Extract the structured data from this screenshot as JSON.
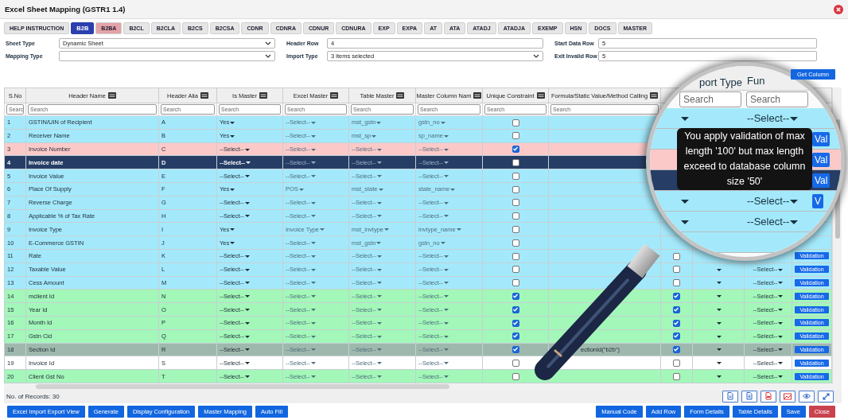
{
  "window": {
    "title": "Excel Sheet Mapping (GSTR1 1.4)"
  },
  "tabs": [
    {
      "label": "HELP INSTRUCTION",
      "selected": false,
      "color": "#e6e6e6"
    },
    {
      "label": "B2B",
      "selected": true
    },
    {
      "label": "B2BA",
      "selected": false,
      "color": "#e4a3a8"
    },
    {
      "label": "B2CL",
      "selected": false,
      "color": "#e6e6e6"
    },
    {
      "label": "B2CLA",
      "selected": false,
      "color": "#e6e6e6"
    },
    {
      "label": "B2CS",
      "selected": false,
      "color": "#e6e6e6"
    },
    {
      "label": "B2CSA",
      "selected": false,
      "color": "#e6e6e6"
    },
    {
      "label": "CDNR",
      "selected": false,
      "color": "#e6e6e6"
    },
    {
      "label": "CDNRA",
      "selected": false,
      "color": "#e6e6e6"
    },
    {
      "label": "CDNUR",
      "selected": false,
      "color": "#e6e6e6"
    },
    {
      "label": "CDNURA",
      "selected": false,
      "color": "#e6e6e6"
    },
    {
      "label": "EXP",
      "selected": false,
      "color": "#e6e6e6"
    },
    {
      "label": "EXPA",
      "selected": false,
      "color": "#e6e6e6"
    },
    {
      "label": "AT",
      "selected": false,
      "color": "#e6e6e6"
    },
    {
      "label": "ATA",
      "selected": false,
      "color": "#e6e6e6"
    },
    {
      "label": "ATADJ",
      "selected": false,
      "color": "#e6e6e6"
    },
    {
      "label": "ATADJA",
      "selected": false,
      "color": "#e6e6e6"
    },
    {
      "label": "EXEMP",
      "selected": false,
      "color": "#e6e6e6"
    },
    {
      "label": "HSN",
      "selected": false,
      "color": "#e6e6e6"
    },
    {
      "label": "DOCS",
      "selected": false,
      "color": "#e6e6e6"
    },
    {
      "label": "MASTER",
      "selected": false,
      "color": "#e6e6e6"
    }
  ],
  "form": {
    "fields": [
      {
        "label": "Sheet Type",
        "kind": "select",
        "value": "Dynamic Sheet"
      },
      {
        "label": "Header Row",
        "kind": "input",
        "value": "4"
      },
      {
        "label": "Start Data Row",
        "kind": "input",
        "value": "5"
      },
      {
        "label": "Mapping Type",
        "kind": "select"
      },
      {
        "label": "Import Type",
        "kind": "select",
        "value": "3 items selected"
      },
      {
        "label": "Exit Invalid Row",
        "kind": "input",
        "value": "5"
      }
    ]
  },
  "get_column_button": "Get Column",
  "table": {
    "columns": [
      {
        "label": "S.No",
        "search_placeholder": "Searc",
        "menu": false
      },
      {
        "label": "Header Name",
        "search_placeholder": "Search",
        "menu": true
      },
      {
        "label": "Header Alia",
        "search_placeholder": "Search",
        "menu": true
      },
      {
        "label": "Is Master",
        "search_placeholder": "Search",
        "menu": true
      },
      {
        "label": "Excel Master",
        "search_placeholder": "Search",
        "menu": true
      },
      {
        "label": "Table Master",
        "search_placeholder": "Search",
        "menu": true
      },
      {
        "label": "Master Column Nam",
        "search_placeholder": "Search",
        "menu": true
      },
      {
        "label": "Unique Constraint",
        "search_placeholder": "Search",
        "menu": true
      },
      {
        "label": "Formula/Static Value/Method Calling",
        "search_placeholder": "Search",
        "menu": true
      }
    ],
    "rows": [
      {
        "sno": "1",
        "header_name": "GSTIN/UIN of Recipient",
        "alias": "A",
        "is_master": "Yes",
        "excel_master": "--Select--",
        "table_master": "mst_gstn",
        "master_column": "gstn_no",
        "unique": false,
        "selected": false,
        "color": "#a4e9fb"
      },
      {
        "sno": "2",
        "header_name": "Receiver Name",
        "alias": "B",
        "is_master": "Yes",
        "excel_master": "--Select--",
        "table_master": "mst_sp",
        "master_column": "sp_name",
        "unique": false,
        "selected": false,
        "color": "#a4e9fb"
      },
      {
        "sno": "3",
        "header_name": "Invoice Number",
        "alias": "C",
        "is_master": "--Select--",
        "excel_master": "--Select--",
        "table_master": "--Select--",
        "master_column": "--Select--",
        "unique": true,
        "selected": false,
        "color": "#fcc9c9"
      },
      {
        "sno": "4",
        "header_name": "Invoice date",
        "alias": "D",
        "is_master": "--Select--",
        "excel_master": "--Select--",
        "table_master": "--Select--",
        "master_column": "--Select--",
        "unique": false,
        "selected": true
      },
      {
        "sno": "5",
        "header_name": "Invoice Value",
        "alias": "E",
        "is_master": "--Select--",
        "excel_master": "--Select--",
        "table_master": "--Select--",
        "master_column": "--Select--",
        "unique": false,
        "selected": false,
        "color": "#a4e9fb"
      },
      {
        "sno": "6",
        "header_name": "Place Of Supply",
        "alias": "F",
        "is_master": "Yes",
        "excel_master": "POS",
        "table_master": "mst_state",
        "master_column": "state_name",
        "unique": false,
        "selected": false,
        "color": "#a4e9fb"
      },
      {
        "sno": "7",
        "header_name": "Reverse Charge",
        "alias": "G",
        "is_master": "--Select--",
        "excel_master": "--Select--",
        "table_master": "--Select--",
        "master_column": "--Select--",
        "unique": false,
        "selected": false,
        "color": "#a4e9fb"
      },
      {
        "sno": "8",
        "header_name": "Applicable % of Tax Rate",
        "alias": "H",
        "is_master": "--Select--",
        "excel_master": "--Select--",
        "table_master": "--Select--",
        "master_column": "--Select--",
        "unique": false,
        "selected": false,
        "color": "#a4e9fb"
      },
      {
        "sno": "9",
        "header_name": "Invoice Type",
        "alias": "I",
        "is_master": "Yes",
        "excel_master": "Invoice Type",
        "table_master": "mst_invtype",
        "master_column": "invtype_name",
        "unique": false,
        "selected": false,
        "color": "#a4e9fb"
      },
      {
        "sno": "10",
        "header_name": "E-Commerce GSTIN",
        "alias": "J",
        "is_master": "Yes",
        "excel_master": "--Select--",
        "table_master": "mst_gstn",
        "master_column": "gstn_no",
        "unique": false,
        "selected": false,
        "color": "#a4e9fb"
      },
      {
        "sno": "11",
        "header_name": "Rate",
        "alias": "K",
        "is_master": "--Select--",
        "excel_master": "--Select--",
        "table_master": "--Select--",
        "master_column": "--Select--",
        "unique": false,
        "selected": false,
        "color": "#a4e9fb",
        "flag": false,
        "validation": "Validation"
      },
      {
        "sno": "12",
        "header_name": "Taxable Value",
        "alias": "L",
        "is_master": "--Select--",
        "excel_master": "--Select--",
        "table_master": "--Select--",
        "master_column": "--Select--",
        "unique": false,
        "selected": false,
        "color": "#a4e9fb",
        "flag": false,
        "function": "--Select--",
        "validation": "Validation"
      },
      {
        "sno": "13",
        "header_name": "Cess Amount",
        "alias": "M",
        "is_master": "--Select--",
        "excel_master": "--Select--",
        "table_master": "--Select--",
        "master_column": "--Select--",
        "unique": false,
        "selected": false,
        "color": "#a4e9fb",
        "flag": false,
        "function": "--Select--",
        "validation": "Validation"
      },
      {
        "sno": "14",
        "header_name": "mclient Id",
        "alias": "N",
        "is_master": "--Select--",
        "excel_master": "--Select--",
        "table_master": "--Select--",
        "master_column": "--Select--",
        "unique": true,
        "selected": false,
        "color": "#a3f7b9",
        "flag": true,
        "function": "--Select--",
        "validation": "Validation"
      },
      {
        "sno": "15",
        "header_name": "Year Id",
        "alias": "O",
        "is_master": "--Select--",
        "excel_master": "--Select--",
        "table_master": "--Select--",
        "master_column": "--Select--",
        "unique": true,
        "selected": false,
        "color": "#a3f7b9",
        "flag": true,
        "function": "--Select--",
        "validation": "Validation"
      },
      {
        "sno": "16",
        "header_name": "Month Id",
        "alias": "P",
        "is_master": "--Select--",
        "excel_master": "--Select--",
        "table_master": "--Select--",
        "master_column": "--Select--",
        "unique": true,
        "selected": false,
        "color": "#a3f7b9",
        "flag": true,
        "function": "--Select--",
        "validation": "Validation"
      },
      {
        "sno": "17",
        "header_name": "Gstn Cid",
        "alias": "Q",
        "is_master": "--Select--",
        "excel_master": "--Select--",
        "table_master": "--Select--",
        "master_column": "--Select--",
        "unique": true,
        "selected": false,
        "color": "#a3f7b9",
        "flag": true,
        "function": "--Select--",
        "validation": "Validation"
      },
      {
        "sno": "18",
        "header_name": "Section Id",
        "alias": "R",
        "is_master": "--Select--",
        "excel_master": "--Select--",
        "table_master": "--Select--",
        "master_column": "--Select--",
        "unique": true,
        "selected": false,
        "color": "#9fb8ad",
        "formula": "ectionId(\"b2b\")",
        "flag": true,
        "function": "--Select--",
        "validation": "Validation"
      },
      {
        "sno": "19",
        "header_name": "Invoice Id",
        "alias": "S",
        "is_master": "--Select--",
        "excel_master": "--Select--",
        "table_master": "--Select--",
        "master_column": "--Select--",
        "unique": false,
        "selected": false,
        "color": "#ffffff",
        "flag": false,
        "function": "--Select--",
        "validation": "Validation"
      },
      {
        "sno": "20",
        "header_name": "Client Gst No",
        "alias": "T",
        "is_master": "--Select--",
        "excel_master": "--Select--",
        "table_master": "--Select--",
        "master_column": "--Select--",
        "unique": false,
        "selected": false,
        "color": "#a3f7b9",
        "flag": false,
        "function": "--Select--",
        "validation": "Validation"
      }
    ]
  },
  "magnifier": {
    "columns": [
      "port Type",
      "Fun"
    ],
    "search_placeholders": [
      "Search",
      "Search"
    ],
    "rows": [
      {
        "color": "#a4e9fb",
        "function": "--Select--"
      },
      {
        "color": "#a4e9fb",
        "button": "Val"
      },
      {
        "color": "#fcc9c9",
        "button": "Val"
      },
      {
        "color": "#263e66",
        "button": "Val"
      },
      {
        "color": "#a4e9fb",
        "function": "--Select--",
        "button": "V"
      },
      {
        "color": "#a4e9fb",
        "function": "--Select--"
      },
      {
        "color": "#a4e9fb"
      }
    ],
    "tooltip": "You apply validation of max length '100' but max length exceed to database column size '50'"
  },
  "footer": {
    "records": "No. of Records: 30",
    "left_buttons": [
      "Excel Import Export View",
      "Generate",
      "Display Configuration",
      "Master Mapping",
      "Auto Fill"
    ],
    "right_buttons": [
      {
        "label": "Manual Code",
        "kind": "primary"
      },
      {
        "label": "Add Row",
        "kind": "primary"
      },
      {
        "label": "Form Details",
        "kind": "primary"
      },
      {
        "label": "Table Details",
        "kind": "primary"
      },
      {
        "label": "Save",
        "kind": "primary"
      },
      {
        "label": "Close",
        "kind": "danger"
      }
    ]
  }
}
